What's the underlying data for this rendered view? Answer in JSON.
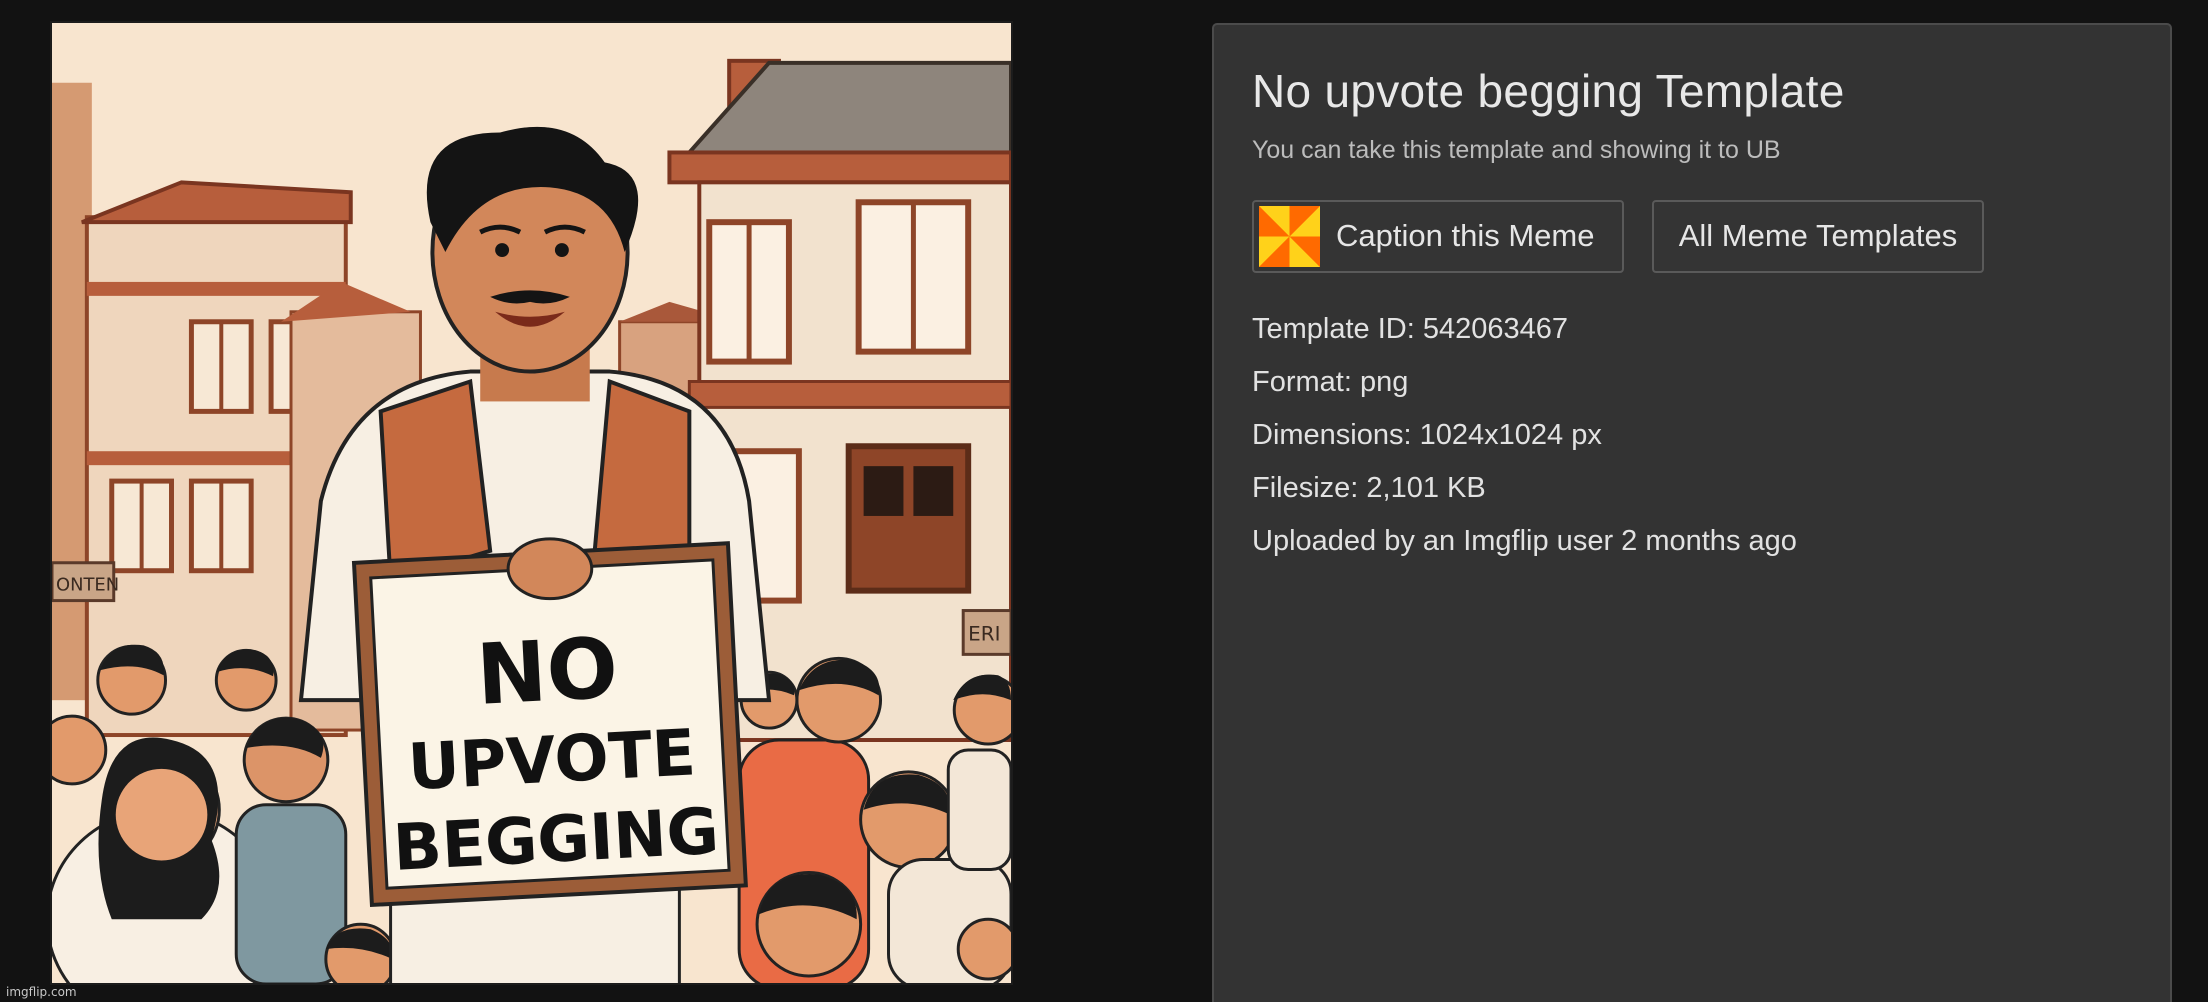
{
  "meme_image": {
    "sign_lines": [
      "NO",
      "UPVOTE",
      "BEGGING"
    ],
    "storefront_signs": [
      "ONTEN",
      "ERI"
    ],
    "watermark": "imgflip.com"
  },
  "panel": {
    "title": "No upvote begging Template",
    "subtitle": "You can take this template and showing it to UB",
    "caption_button": "Caption this Meme",
    "all_templates_button": "All Meme Templates",
    "template_id": "Template ID: 542063467",
    "format": "Format: png",
    "dimensions": "Dimensions: 1024x1024 px",
    "filesize": "Filesize: 2,101 KB",
    "uploaded": "Uploaded by an Imgflip user 2 months ago"
  },
  "icons": {
    "caption": "pinwheel-icon"
  },
  "colors": {
    "page_bg": "#121212",
    "panel_bg": "#333333",
    "panel_border": "#4b4b4b",
    "text_primary": "#e6e6e6",
    "text_secondary": "#bcbcbc",
    "icon_yellow": "#ffd21a",
    "icon_orange": "#ff7a00"
  }
}
